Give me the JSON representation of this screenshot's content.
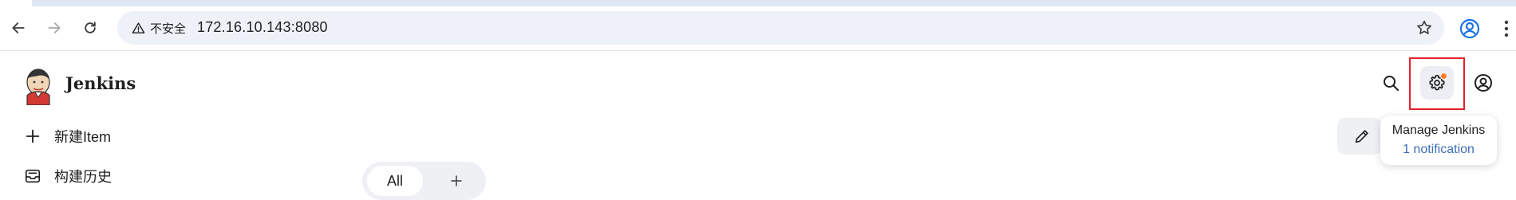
{
  "browser": {
    "security_label": "不安全",
    "url": "172.16.10.143:8080",
    "icons": {
      "back": "back-arrow-icon",
      "forward": "forward-arrow-icon",
      "reload": "reload-icon",
      "warning": "warning-triangle-icon",
      "bookmark": "star-icon",
      "profile": "profile-icon",
      "menu": "kebab-menu-icon"
    }
  },
  "header": {
    "brand": "Jenkins",
    "icons": {
      "logo": "jenkins-logo",
      "search": "search-icon",
      "manage": "gear-icon",
      "user": "user-circle-icon"
    },
    "manage_tooltip": {
      "title": "Manage Jenkins",
      "subtitle": "1 notification"
    },
    "notification_color": "#ff7a2e",
    "highlight_color": "#e5202a"
  },
  "sidebar": {
    "items": [
      {
        "label": "新建Item",
        "icon": "plus-icon"
      },
      {
        "label": "构建历史",
        "icon": "inbox-icon"
      }
    ]
  },
  "views": {
    "tabs": [
      {
        "label": "All",
        "active": true
      }
    ],
    "add_icon": "plus-icon"
  },
  "actions": {
    "edit_icon": "pencil-icon"
  }
}
